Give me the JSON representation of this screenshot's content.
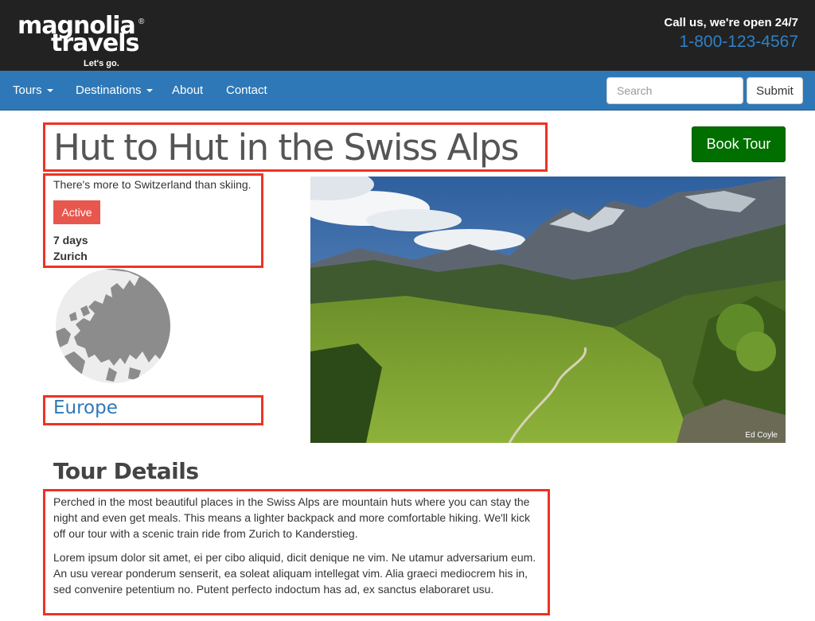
{
  "header": {
    "logo_line1": "magnolia",
    "logo_line2": "travels",
    "logo_registered": "®",
    "logo_tagline": "Let's go.",
    "contact_text": "Call us, we're open 24/7",
    "phone": "1-800-123-4567"
  },
  "nav": {
    "items": [
      {
        "label": "Tours",
        "dropdown": true
      },
      {
        "label": "Destinations",
        "dropdown": true
      },
      {
        "label": "About",
        "dropdown": false
      },
      {
        "label": "Contact",
        "dropdown": false
      }
    ],
    "search_placeholder": "Search",
    "submit_label": "Submit"
  },
  "tour": {
    "title": "Hut to Hut in the Swiss Alps",
    "book_label": "Book Tour",
    "subtitle": "There's more to Switzerland than skiing.",
    "status": "Active",
    "duration": "7 days",
    "location": "Zurich",
    "region": "Europe",
    "image_credit": "Ed Coyle"
  },
  "details": {
    "heading": "Tour Details",
    "paragraph1": "Perched in the most beautiful places in the Swiss Alps are mountain huts where you can stay the night and even get meals. This means a lighter backpack and more comfortable hiking. We'll kick off our tour with a scenic train ride from Zurich to Kanderstieg.",
    "paragraph2": "Lorem ipsum dolor sit amet, ei per cibo aliquid, dicit denique ne vim. Ne utamur adversarium eum. An usu verear ponderum senserit, ea soleat aliquam intellegat vim. Alia graeci mediocrem his in, sed convenire petentium no. Putent perfecto indoctum has ad, ex sanctus elaboraret usu."
  },
  "colors": {
    "header_bg": "#222222",
    "nav_bg": "#2f78b7",
    "phone": "#2f80c7",
    "book_button": "#006f00",
    "status_badge": "#e8574d",
    "annotation_box": "#ee3322",
    "link": "#2f78b7"
  }
}
